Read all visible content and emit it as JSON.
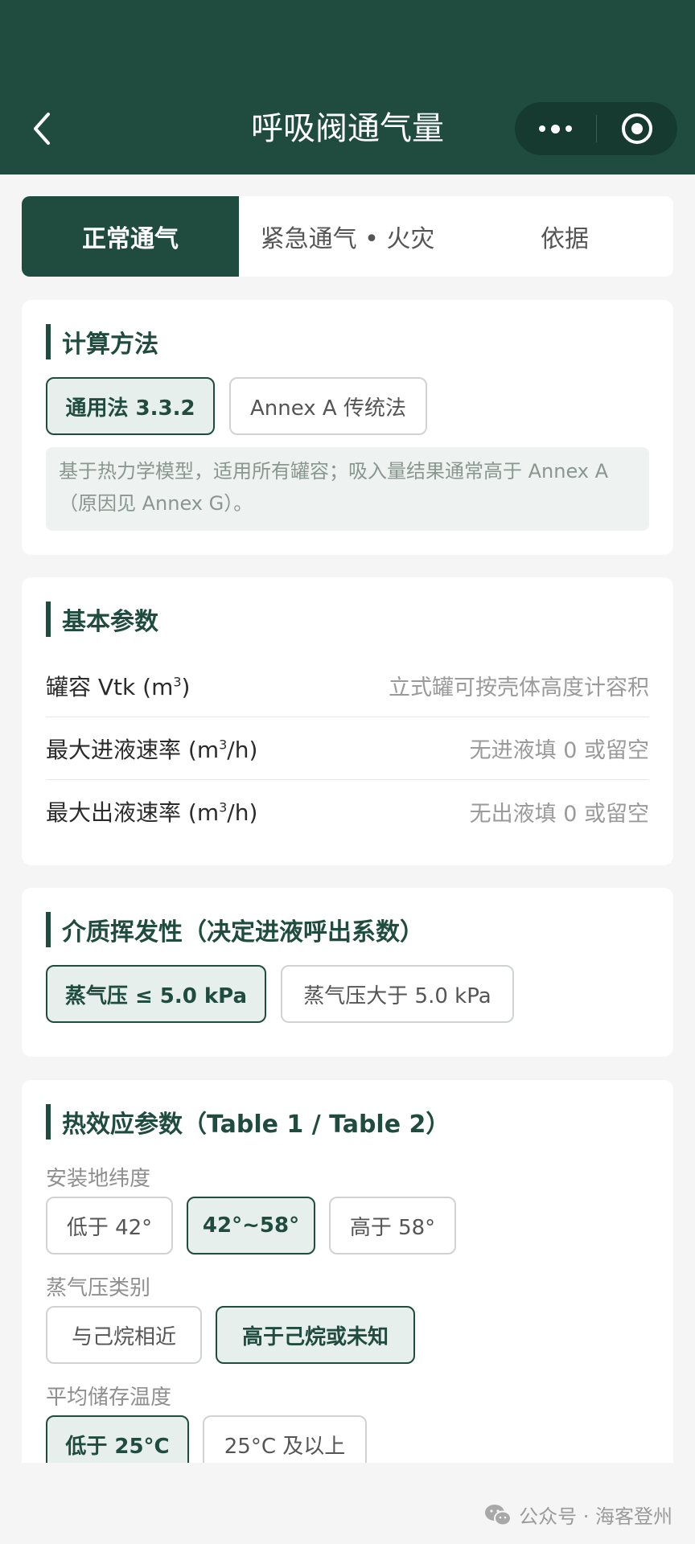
{
  "header": {
    "title": "呼吸阀通气量"
  },
  "tabs": [
    {
      "label": "正常通气",
      "active": true
    },
    {
      "label": "紧急通气 • 火灾",
      "active": false
    },
    {
      "label": "依据",
      "active": false
    }
  ],
  "method": {
    "title": "计算方法",
    "options": [
      {
        "label": "通用法 3.3.2",
        "selected": true
      },
      {
        "label": "Annex A 传统法",
        "selected": false
      }
    ],
    "note": "基于热力学模型，适用所有罐容；吸入量结果通常高于 Annex A（原因见 Annex G）。"
  },
  "basic": {
    "title": "基本参数",
    "fields": [
      {
        "label_prefix": "罐容 Vtk (m",
        "label_sup": "3",
        "label_suffix": ")",
        "placeholder": "立式罐可按壳体高度计容积"
      },
      {
        "label_prefix": "最大进液速率 (m",
        "label_sup": "3",
        "label_suffix": "/h)",
        "placeholder": "无进液填 0 或留空"
      },
      {
        "label_prefix": "最大出液速率 (m",
        "label_sup": "3",
        "label_suffix": "/h)",
        "placeholder": "无出液填 0 或留空"
      }
    ]
  },
  "volatility": {
    "title": "介质挥发性（决定进液呼出系数）",
    "options": [
      {
        "label": "蒸气压 ≤ 5.0 kPa",
        "selected": true
      },
      {
        "label": "蒸气压大于 5.0 kPa",
        "selected": false
      }
    ]
  },
  "thermal": {
    "title": "热效应参数（Table 1 / Table 2）",
    "latitude": {
      "label": "安装地纬度",
      "options": [
        {
          "label": "低于 42°",
          "selected": false
        },
        {
          "label": "42°~58°",
          "selected": true
        },
        {
          "label": "高于 58°",
          "selected": false
        }
      ]
    },
    "vapor_class": {
      "label": "蒸气压类别",
      "options": [
        {
          "label": "与己烷相近",
          "selected": false
        },
        {
          "label": "高于己烷或未知",
          "selected": true
        }
      ]
    },
    "temperature": {
      "label": "平均储存温度",
      "options": [
        {
          "label": "低于 25°C",
          "selected": true
        },
        {
          "label": "25°C 及以上",
          "selected": false
        }
      ]
    }
  },
  "watermark": {
    "text": "公众号 · 海客登州"
  },
  "colors": {
    "primary": "#1f4c3f",
    "selected_bg": "#e6efeb",
    "page_bg": "#f4f5f4"
  }
}
